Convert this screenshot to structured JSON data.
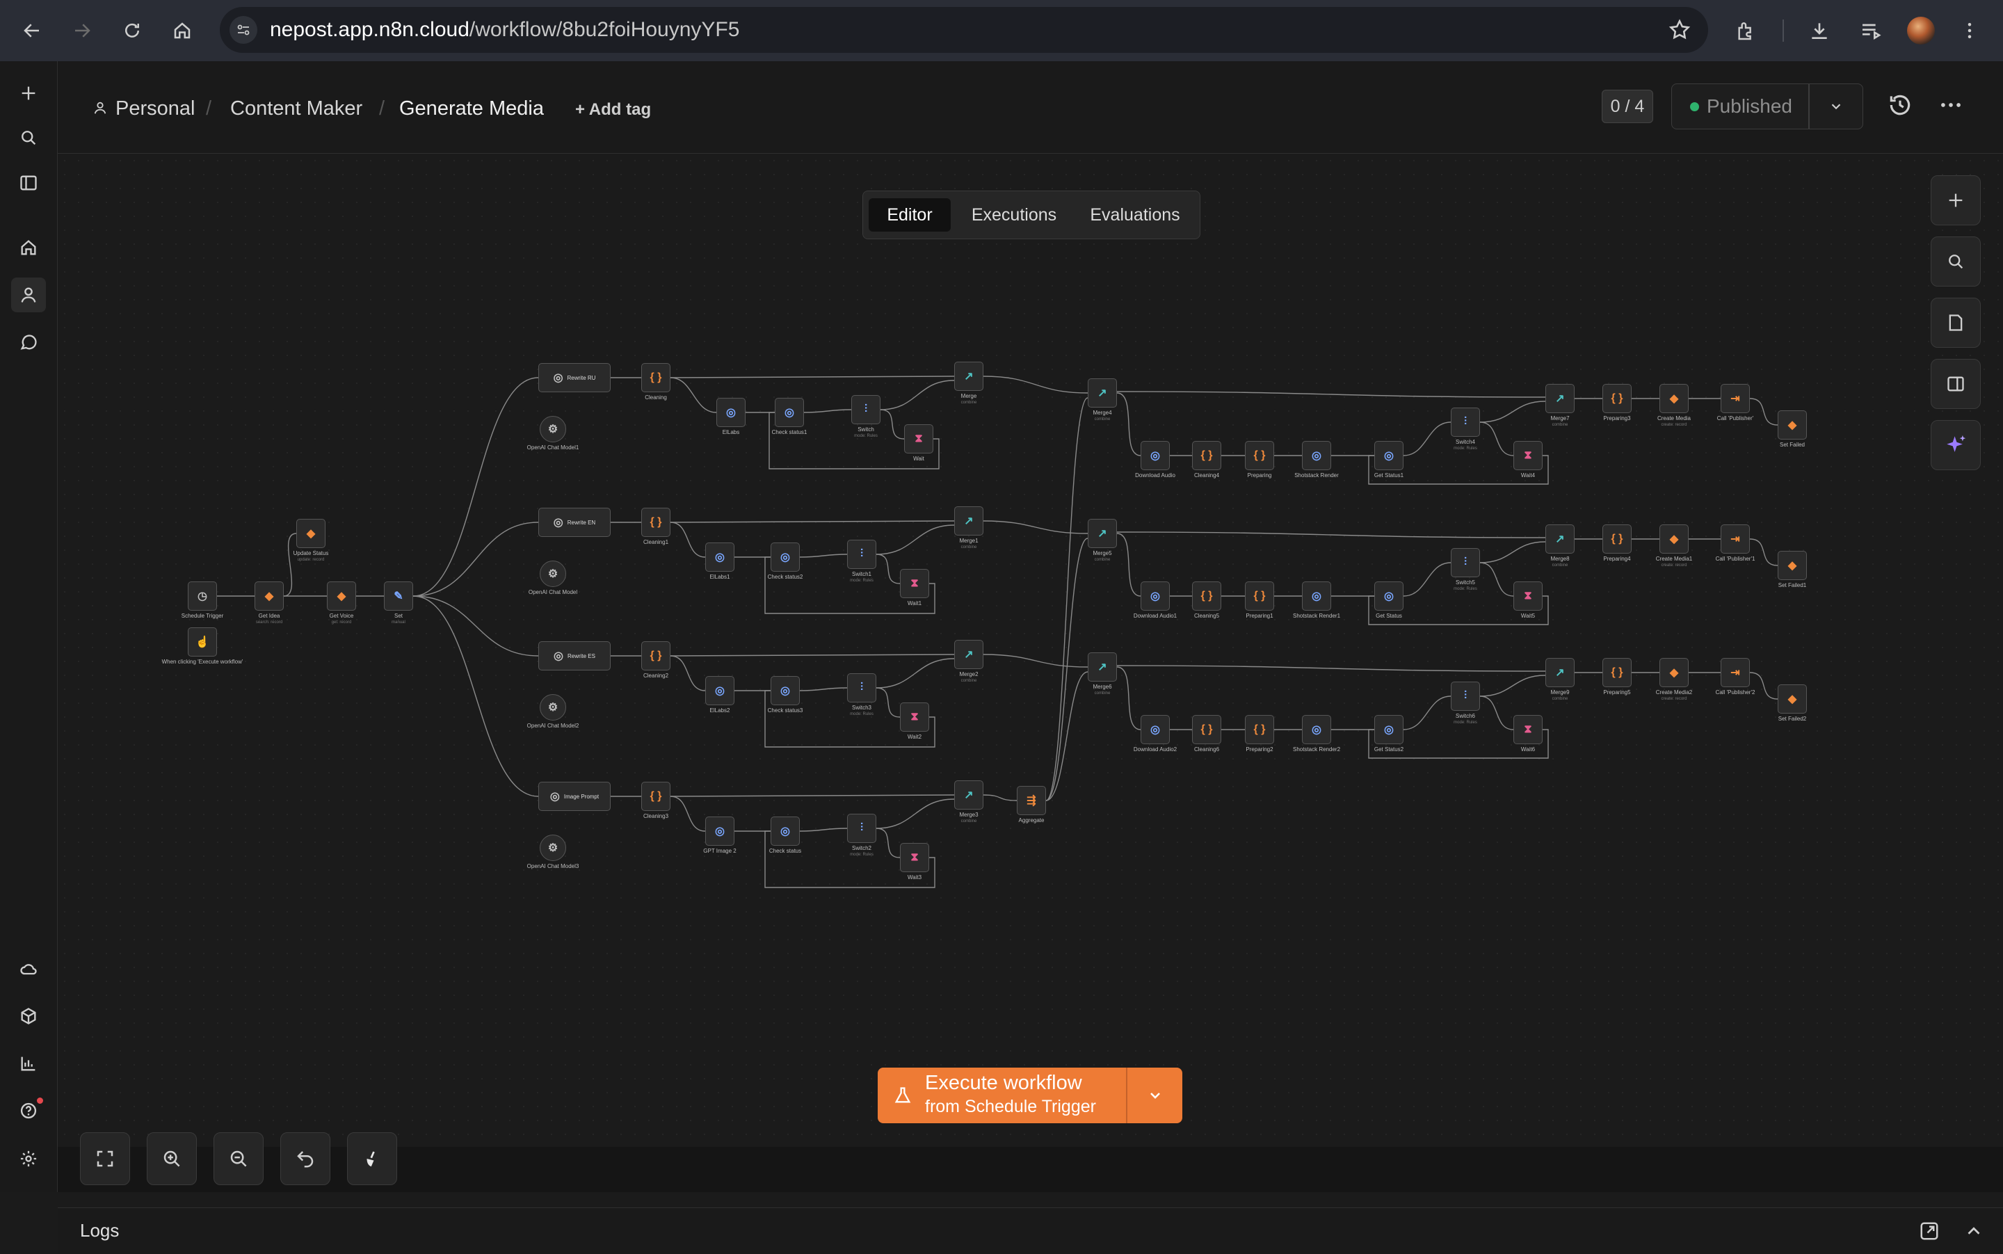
{
  "browser": {
    "url_host": "nepost.app.n8n.cloud",
    "url_path": "/workflow/8bu2foiHouynyYF5"
  },
  "header": {
    "breadcrumb": [
      "Personal",
      "Content Maker",
      "Generate Media"
    ],
    "add_tag": "+ Add tag",
    "counter": "0 / 4",
    "publish_status": "Published"
  },
  "tabs": [
    "Editor",
    "Executions",
    "Evaluations"
  ],
  "active_tab": "Editor",
  "execute": {
    "label": "Execute workflow",
    "sublabel": "from Schedule Trigger"
  },
  "logs": {
    "label": "Logs"
  },
  "colors": {
    "accent": "#ee7b35",
    "success": "#2fb36d"
  },
  "nodes": {
    "schedule_trigger": "Schedule Trigger",
    "manual_trigger": "When clicking 'Execute workflow'",
    "get_idea": "Get Idea",
    "get_idea_sub": "search: record",
    "update_status": "Update Status",
    "update_status_sub": "update: record",
    "get_voice": "Get Voice",
    "get_voice_sub": "get: record",
    "set": "Set",
    "set_sub": "manual",
    "rewrite_ru": "Rewrite RU",
    "rewrite_en": "Rewrite EN",
    "rewrite_es": "Rewrite ES",
    "image_prompt": "Image Prompt",
    "model1": "OpenAI Chat Model1",
    "model": "OpenAI Chat Model",
    "model2": "OpenAI Chat Model2",
    "model3": "OpenAI Chat Model3",
    "cleaning": "Cleaning",
    "cleaning1": "Cleaning1",
    "cleaning2": "Cleaning2",
    "cleaning3": "Cleaning3",
    "elabs": "ElLabs",
    "elabs1": "ElLabs1",
    "elabs2": "ElLabs2",
    "gpt_image": "GPT Image 2",
    "check_status1": "Check status1",
    "check_status2": "Check status2",
    "check_status3": "Check status3",
    "check_status": "Check status",
    "switch": "Switch",
    "switch1": "Switch1",
    "switch3": "Switch3",
    "switch2": "Switch2",
    "switch4": "Switch4",
    "switch5": "Switch5",
    "switch6": "Switch6",
    "mode_rules": "mode: Rules",
    "wait": "Wait",
    "wait1": "Wait1",
    "wait2": "Wait2",
    "wait3": "Wait3",
    "wait4": "Wait4",
    "wait5": "Wait5",
    "wait6": "Wait6",
    "merge": "Merge",
    "merge1": "Merge1",
    "merge2": "Merge2",
    "merge3": "Merge3",
    "merge4": "Merge4",
    "merge5": "Merge5",
    "merge6": "Merge6",
    "merge7": "Merge7",
    "merge8": "Merge8",
    "merge9": "Merge9",
    "combine": "combine",
    "aggregate": "Aggregate",
    "download_audio": "Download Audio",
    "download_audio1": "Download Audio1",
    "download_audio2": "Download Audio2",
    "cleaning4": "Cleaning4",
    "cleaning5": "Cleaning5",
    "cleaning6": "Cleaning6",
    "preparing": "Preparing",
    "preparing1": "Preparing1",
    "preparing2": "Preparing2",
    "preparing3": "Preparing3",
    "preparing4": "Preparing4",
    "preparing5": "Preparing5",
    "shotstack": "Shotstack Render",
    "shotstack1": "Shotstack Render1",
    "shotstack2": "Shotstack Render2",
    "get_status1": "Get Status1",
    "get_status": "Get Status",
    "get_status2": "Get Status2",
    "create_media": "Create Media",
    "create_media1": "Create Media1",
    "create_media2": "Create Media2",
    "create_record": "create: record",
    "call_publisher": "Call 'Publisher'",
    "call_publisher1": "Call 'Publisher'1",
    "call_publisher2": "Call 'Publisher'2",
    "set_failed": "Set Failed",
    "set_failed1": "Set Failed1",
    "set_failed2": "Set Failed2"
  }
}
